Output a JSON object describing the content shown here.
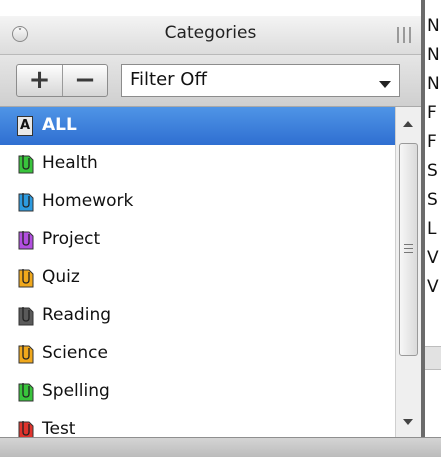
{
  "header": {
    "title": "Categories",
    "collapse_icon": "circle-chevron-icon",
    "grip_icon": "column-grip-icon"
  },
  "toolbar": {
    "add_label": "+",
    "remove_label": "−",
    "filter": {
      "selected_value": "Filter Off"
    }
  },
  "categories": {
    "items": [
      {
        "label": "ALL",
        "icon": "all-icon",
        "color": "#e9e9e9",
        "selected": true
      },
      {
        "label": "Health",
        "icon": "tag-icon",
        "color": "#39c43c"
      },
      {
        "label": "Homework",
        "icon": "tag-icon",
        "color": "#2d9be0"
      },
      {
        "label": "Project",
        "icon": "tag-icon",
        "color": "#b24fe0"
      },
      {
        "label": "Quiz",
        "icon": "tag-icon",
        "color": "#f0a81c"
      },
      {
        "label": "Reading",
        "icon": "tag-icon",
        "color": "#5a5a5a"
      },
      {
        "label": "Science",
        "icon": "tag-icon",
        "color": "#f0a81c"
      },
      {
        "label": "Spelling",
        "icon": "tag-icon",
        "color": "#39c43c"
      },
      {
        "label": "Test",
        "icon": "tag-icon",
        "color": "#e0342d"
      }
    ]
  },
  "right_panel": {
    "letters": [
      "N",
      "N",
      "N",
      "F",
      "F",
      "S",
      "S",
      "L",
      "V",
      "V"
    ]
  },
  "colors": {
    "selection": "#3b7fdc",
    "divider": "#6b6b6b"
  }
}
